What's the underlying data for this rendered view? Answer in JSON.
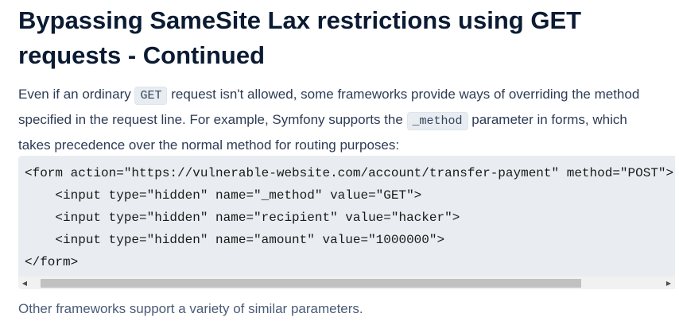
{
  "heading": {
    "title": "Bypassing SameSite Lax restrictions using GET requests - Continued"
  },
  "intro": {
    "part1": "Even if an ordinary ",
    "code1": "GET",
    "part2": " request isn't allowed, some frameworks provide ways of overriding the method specified in the request line. For example, Symfony supports the ",
    "code2": "_method",
    "part3": " parameter in forms, which takes precedence over the normal method for routing purposes:"
  },
  "code_block": {
    "lines": [
      "<form action=\"https://vulnerable-website.com/account/transfer-payment\" method=\"POST\">",
      "    <input type=\"hidden\" name=\"_method\" value=\"GET\">",
      "    <input type=\"hidden\" name=\"recipient\" value=\"hacker\">",
      "    <input type=\"hidden\" name=\"amount\" value=\"1000000\">",
      "</form>"
    ]
  },
  "scrollbar": {
    "left_arrow": "◀",
    "right_arrow": "▶"
  },
  "outro": {
    "text": "Other frameworks support a variety of similar parameters."
  }
}
